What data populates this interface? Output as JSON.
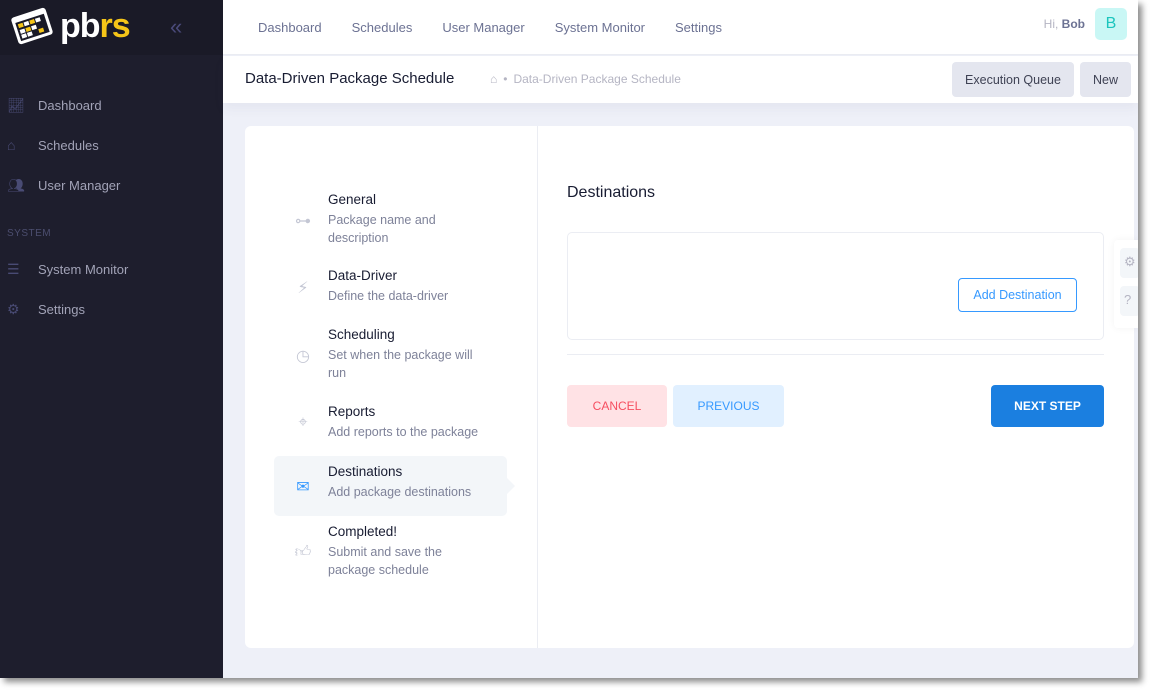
{
  "brand": {
    "logo_text": "pbrs"
  },
  "sidebar": {
    "items": [
      {
        "label": "Dashboard",
        "icon": "chart-line-icon"
      },
      {
        "label": "Schedules",
        "icon": "home-icon"
      },
      {
        "label": "User Manager",
        "icon": "users-icon"
      }
    ],
    "section_label": "SYSTEM",
    "system_items": [
      {
        "label": "System Monitor",
        "icon": "list-check-icon"
      },
      {
        "label": "Settings",
        "icon": "gear-icon"
      }
    ]
  },
  "topnav": {
    "items": [
      "Dashboard",
      "Schedules",
      "User Manager",
      "System Monitor",
      "Settings"
    ],
    "greeting": "Hi,",
    "user": "Bob",
    "avatar": "B"
  },
  "subheader": {
    "title": "Data-Driven Package Schedule",
    "breadcrumb": "Data-Driven Package Schedule",
    "execution_queue": "Execution Queue",
    "new": "New"
  },
  "steps": [
    {
      "title": "General",
      "desc": "Package name and description"
    },
    {
      "title": "Data-Driver",
      "desc": "Define the data-driver"
    },
    {
      "title": "Scheduling",
      "desc": "Set when the package will run"
    },
    {
      "title": "Reports",
      "desc": "Add reports to the package"
    },
    {
      "title": "Destinations",
      "desc": "Add package destinations",
      "active": true
    },
    {
      "title": "Completed!",
      "desc": "Submit and save the package schedule"
    }
  ],
  "main": {
    "title": "Destinations",
    "add_destination": "Add Destination",
    "cancel": "CANCEL",
    "previous": "PREVIOUS",
    "next": "NEXT STEP"
  },
  "colors": {
    "primary": "#1b7fe0",
    "danger_bg": "#ffe2e5",
    "danger": "#f64e60",
    "info_bg": "#e1f0ff",
    "info": "#3699ff",
    "sidebar": "#1e1e2d"
  }
}
